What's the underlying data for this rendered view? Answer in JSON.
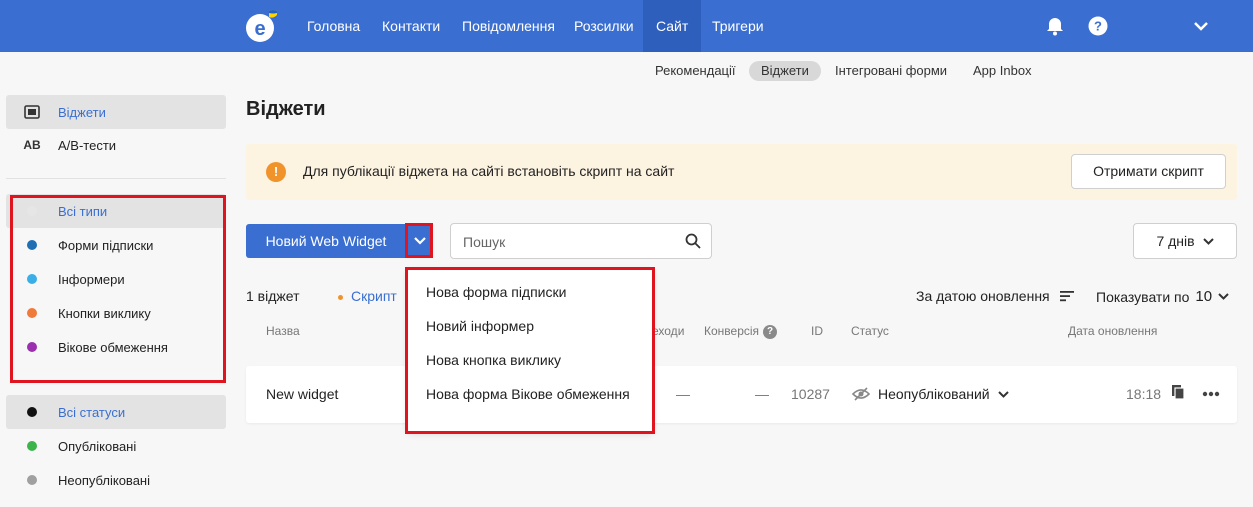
{
  "topnav": {
    "items": [
      "Головна",
      "Контакти",
      "Повідомлення",
      "Розсилки",
      "Сайт",
      "Тригери"
    ],
    "active": "Сайт"
  },
  "subnav": {
    "items": [
      "Рекомендації",
      "Віджети",
      "Інтегровані форми",
      "App Inbox"
    ],
    "active": "Віджети"
  },
  "sidebar": {
    "sections": [
      {
        "label": "Віджети",
        "icon": "widget-icon"
      },
      {
        "label": "A/B-тести",
        "icon": "AB"
      }
    ],
    "types": [
      {
        "label": "Всі типи",
        "color": "#e6e6e6"
      },
      {
        "label": "Форми підписки",
        "color": "#1f6fb5"
      },
      {
        "label": "Інформери",
        "color": "#3aaee6"
      },
      {
        "label": "Кнопки виклику",
        "color": "#f07a3a"
      },
      {
        "label": "Вікове обмеження",
        "color": "#9b2fae"
      }
    ],
    "statuses": [
      {
        "label": "Всі статуси",
        "color": "#111111"
      },
      {
        "label": "Опубліковані",
        "color": "#3cb44b"
      },
      {
        "label": "Неопубліковані",
        "color": "#a0a0a0"
      }
    ]
  },
  "page": {
    "title": "Віджети"
  },
  "banner": {
    "icon": "!",
    "text": "Для публікації віджета на сайті встановіть скрипт на сайт",
    "button": "Отримати скрипт"
  },
  "toolbar": {
    "new_button": "Новий Web Widget",
    "search_placeholder": "Пошук",
    "period": "7 днів"
  },
  "list_meta": {
    "count": "1 віджет",
    "script_link": "Скрипт",
    "sort": "За датою оновлення",
    "per_page_label": "Показувати по",
    "per_page_value": "10"
  },
  "table": {
    "headers": {
      "name": "Назва",
      "transitions": "еходи",
      "conversion": "Конверсія",
      "id": "ID",
      "status": "Статус",
      "updated": "Дата оновлення"
    },
    "rows": [
      {
        "name": "New widget",
        "transitions": "—",
        "conversion": "—",
        "id": "10287",
        "status": "Неопублікований",
        "updated": "18:18"
      }
    ]
  },
  "dropdown": {
    "items": [
      "Нова форма підписки",
      "Новий інформер",
      "Нова кнопка виклику",
      "Нова форма Вікове обмеження"
    ]
  },
  "colors": {
    "brand": "#3a6fd1",
    "highlight": "#e0141e",
    "warning": "#f0932b",
    "banner_bg": "#fdf3e1"
  }
}
